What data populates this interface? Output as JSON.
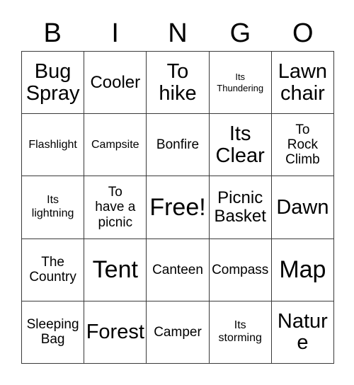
{
  "card": {
    "title_letters": [
      "B",
      "I",
      "N",
      "G",
      "O"
    ],
    "columns": 5,
    "rows": 5,
    "border_color": "#3a3a3a",
    "background_color": "#ffffff",
    "text_color": "#000000",
    "free_space_label": "Free!",
    "free_space_position": "row3-col3",
    "cells": [
      [
        {
          "text": "Bug\nSpray",
          "size": "xl"
        },
        {
          "text": "Cooler",
          "size": "lg"
        },
        {
          "text": "To\nhike",
          "size": "xl"
        },
        {
          "text": "Its\nThundering",
          "size": "xs"
        },
        {
          "text": "Lawn\nchair",
          "size": "xl"
        }
      ],
      [
        {
          "text": "Flashlight",
          "size": "sm"
        },
        {
          "text": "Campsite",
          "size": "sm"
        },
        {
          "text": "Bonfire",
          "size": "md"
        },
        {
          "text": "Its\nClear",
          "size": "xl"
        },
        {
          "text": "To\nRock\nClimb",
          "size": "md"
        }
      ],
      [
        {
          "text": "Its\nlightning",
          "size": "sm"
        },
        {
          "text": "To\nhave a\npicnic",
          "size": "md"
        },
        {
          "text": "Free!",
          "size": "xxl"
        },
        {
          "text": "Picnic\nBasket",
          "size": "lg"
        },
        {
          "text": "Dawn",
          "size": "xl"
        }
      ],
      [
        {
          "text": "The\nCountry",
          "size": "md"
        },
        {
          "text": "Tent",
          "size": "xxl"
        },
        {
          "text": "Canteen",
          "size": "md"
        },
        {
          "text": "Compass",
          "size": "md"
        },
        {
          "text": "Map",
          "size": "xxl"
        }
      ],
      [
        {
          "text": "Sleeping\nBag",
          "size": "md"
        },
        {
          "text": "Forest",
          "size": "xl"
        },
        {
          "text": "Camper",
          "size": "md"
        },
        {
          "text": "Its\nstorming",
          "size": "sm"
        },
        {
          "text": "Nature",
          "size": "xl"
        }
      ]
    ]
  }
}
